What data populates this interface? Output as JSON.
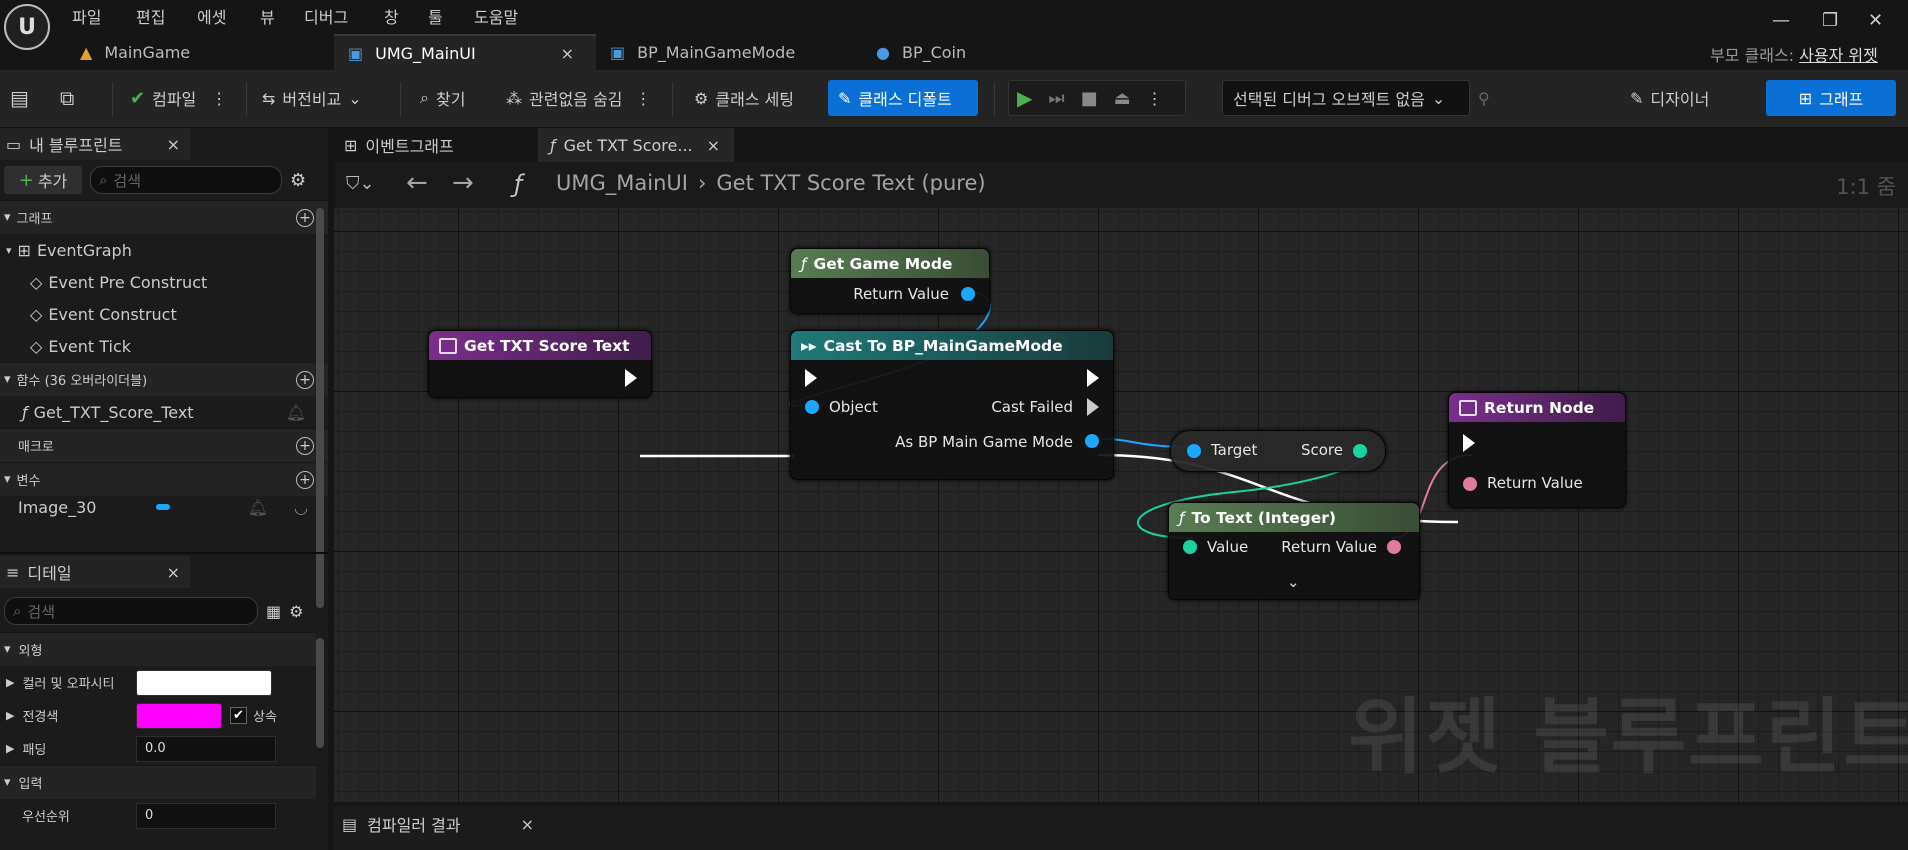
{
  "menu": [
    "파일",
    "편집",
    "에셋",
    "뷰",
    "디버그",
    "창",
    "툴",
    "도움말"
  ],
  "doc_tabs": [
    {
      "label": "MainGame"
    },
    {
      "label": "UMG_MainUI",
      "close": "×"
    },
    {
      "label": "BP_MainGameMode"
    },
    {
      "label": "BP_Coin"
    }
  ],
  "parent_class": {
    "label": "부모 클래스:",
    "value": "사용자 위젯"
  },
  "toolbar": {
    "compile": "컴파일",
    "diff": "버전비교",
    "find": "찾기",
    "hide_unrelated": "관련없음 숨김",
    "class_settings": "클래스 세팅",
    "class_defaults": "클래스 디폴트",
    "debug_object": "선택된 디버그 오브젝트 없음",
    "designer": "디자이너",
    "graph": "그래프"
  },
  "my_blueprint": {
    "title": "내 블루프린트",
    "close": "×",
    "add": "추가",
    "search_placeholder": "검색",
    "graphs_header": "그래프",
    "event_graph": "EventGraph",
    "events": [
      "Event Pre Construct",
      "Event Construct",
      "Event Tick"
    ],
    "functions_header": "함수 (36 오버라이더블)",
    "function_item": "Get_TXT_Score_Text",
    "macros_header": "매크로",
    "variables_header": "변수",
    "variable_item": "Image_30"
  },
  "details": {
    "title": "디테일",
    "close": "×",
    "search_placeholder": "검색",
    "appearance_header": "외형",
    "color_label": "컬러 및 오파시티",
    "fg_label": "전경색",
    "inherit_label": "상속",
    "padding_label": "패딩",
    "padding_value": "0.0",
    "input_header": "입력",
    "priority_label": "우선순위",
    "priority_value": "0",
    "colors": {
      "color_opacity": "#ffffff",
      "foreground": "#ff00ff"
    }
  },
  "graph_tabs": [
    {
      "label": "이벤트그래프"
    },
    {
      "label": "Get TXT Score...",
      "close": "×"
    }
  ],
  "breadcrumb": {
    "root": "UMG_MainUI",
    "current": "Get TXT Score Text (pure)",
    "zoom": "1:1 줌"
  },
  "watermark": "위젯 블루프린트",
  "nodes": {
    "get_game_mode": {
      "title": "Get Game Mode",
      "pin": "Return Value"
    },
    "entry": {
      "title": "Get TXT Score Text"
    },
    "cast": {
      "title": "Cast To BP_MainGameMode",
      "object": "Object",
      "failed": "Cast Failed",
      "as": "As BP Main Game Mode"
    },
    "score": {
      "target": "Target",
      "score": "Score"
    },
    "to_text": {
      "title": "To Text (Integer)",
      "value": "Value",
      "ret": "Return Value"
    },
    "return": {
      "title": "Return Node",
      "ret": "Return Value"
    }
  },
  "compiler_tab": {
    "label": "컴파일러 결과",
    "close": "×"
  },
  "colors": {
    "accent": "#0a70d5",
    "function_header": "#4e6b4a",
    "cast_header": "#1d6b6b",
    "entry_header": "#6a2a7a",
    "object_pin": "#1aa7ff",
    "int_pin": "#1bd3a1",
    "text_pin": "#e07aa0"
  }
}
